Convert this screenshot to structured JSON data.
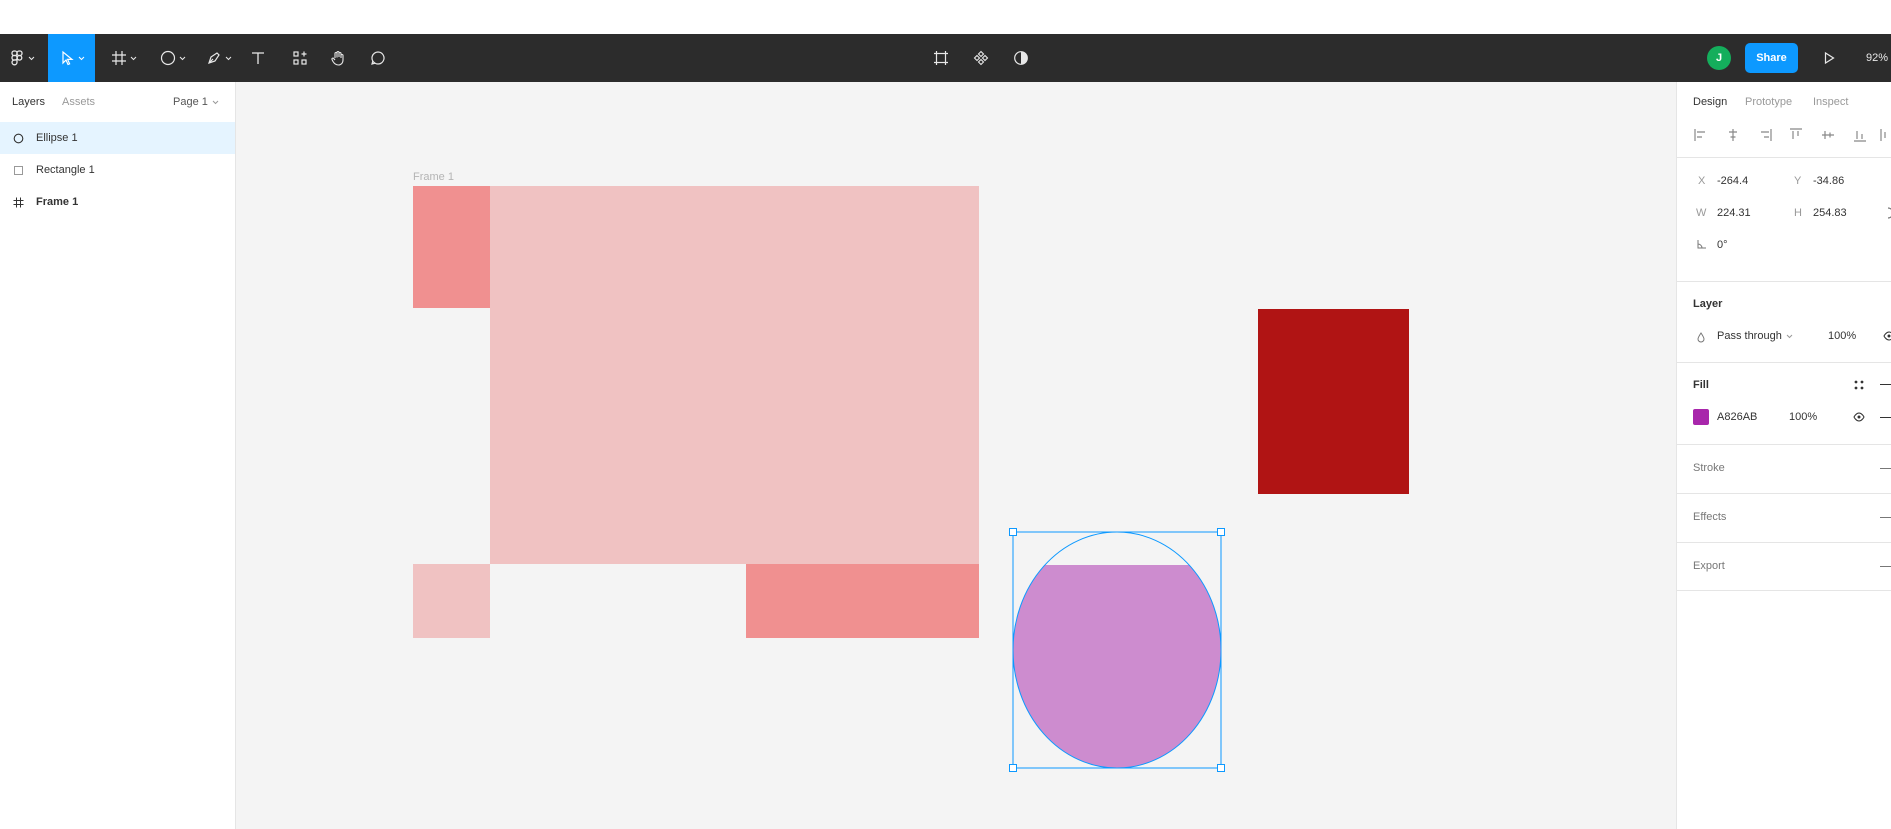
{
  "toolbar": {
    "share_label": "Share",
    "avatar_initial": "J",
    "zoom": "92%",
    "colors": {
      "bar": "#2c2c2c",
      "active": "#0d99ff",
      "avatar": "#14ae5c"
    }
  },
  "left_panel": {
    "tabs": {
      "layers": "Layers",
      "assets": "Assets"
    },
    "page": "Page 1",
    "layers": [
      {
        "name": "Ellipse 1",
        "icon": "ellipse-icon",
        "selected": true
      },
      {
        "name": "Rectangle 1",
        "icon": "rectangle-icon",
        "selected": false
      },
      {
        "name": "Frame 1",
        "icon": "frame-icon",
        "selected": false
      }
    ]
  },
  "canvas": {
    "frame_label": "Frame 1",
    "colors": {
      "background": "#f4f4f4",
      "light_pink": "#f0c2c2",
      "salmon": "#f09090",
      "dark_red": "#b01414",
      "ellipse_fill": "#cd8ccf",
      "selection": "#0d99ff"
    }
  },
  "right_panel": {
    "tabs": {
      "design": "Design",
      "prototype": "Prototype",
      "inspect": "Inspect"
    },
    "x_label": "X",
    "x": "-264.4",
    "y_label": "Y",
    "y": "-34.86",
    "w_label": "W",
    "w": "224.31",
    "h_label": "H",
    "h": "254.83",
    "rotation": "0°",
    "layer_title": "Layer",
    "blend_mode": "Pass through",
    "layer_opacity": "100%",
    "fill_title": "Fill",
    "fill_hex": "A826AB",
    "fill_color": "#a826ab",
    "fill_opacity": "100%",
    "stroke_title": "Stroke",
    "effects_title": "Effects",
    "export_title": "Export"
  }
}
